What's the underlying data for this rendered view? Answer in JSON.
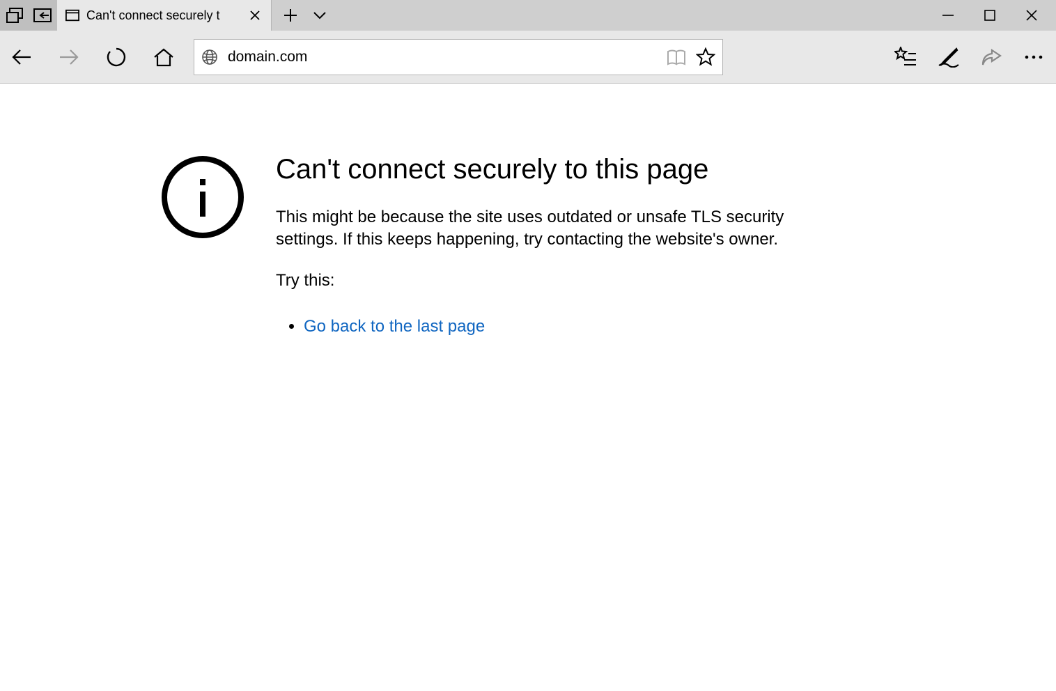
{
  "tab": {
    "title": "Can't connect securely t"
  },
  "address": {
    "value": "domain.com"
  },
  "error": {
    "heading": "Can't connect securely to this page",
    "body": "This might be because the site uses outdated or unsafe TLS security settings. If this keeps happening, try contacting the website's owner.",
    "try_label": "Try this:",
    "go_back_link": "Go back to the last page"
  }
}
